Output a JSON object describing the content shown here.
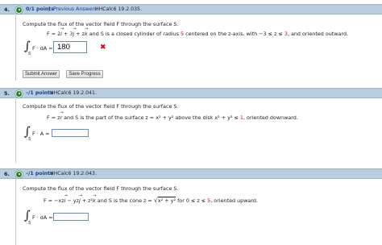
{
  "questions": [
    {
      "number": "4.",
      "points": "0/1 points",
      "separator": "|",
      "previous_answers": "Previous Answers",
      "code": "HHCalc6 19.2.035.",
      "prompt": "Compute the flux of the vector field F through the surface S.",
      "field_prefix": "F = 2",
      "field_i": "i",
      "field_mid1": " + 3",
      "field_j": "j",
      "field_mid2": " + z",
      "field_k": "k",
      "surface_text": " and S is a closed cylinder of radius ",
      "radius": "5",
      "surface_text2": " centered on the z-axis, with −3 ≤ z ≤ ",
      "z_upper": "3",
      "surface_text3": ",  and oriented outward.",
      "integrand": "F · dA =",
      "answer_value": "180",
      "status_mark": "✖",
      "submit_label": "Submit Answer",
      "save_label": "Save Progress"
    },
    {
      "number": "5.",
      "points": "–/1 points",
      "code": "HHCalc6 19.2.041.",
      "prompt": "Compute the flux of the vector field F through the surface S.",
      "field_prefix": "F = z",
      "field_r": "r",
      "surface_text": " and S is the part of the surface  z = x² + y²  above the disk  x² + y² ≤ ",
      "bound": "1",
      "surface_text2": ",  oriented downward.",
      "integrand": "F · A ="
    },
    {
      "number": "6.",
      "points": "–/1 points",
      "code": "HHCalc6 19.2.043.",
      "prompt": "Compute the flux of the vector field F through the surface S.",
      "field_text": "F = −xz",
      "field_i": "i",
      "field_mid1": " − yz",
      "field_j": "j",
      "field_mid2": " + z²",
      "field_k": "k",
      "surface_text": " and S is the cone  z = ",
      "sqrt_text": "x² + y²",
      "surface_text2": "  for  0 ≤ z ≤ ",
      "z_upper": "5",
      "surface_text3": ",  oriented upward.",
      "integrand": "F · dA ="
    }
  ],
  "colors": {
    "header_bg": "#b9cde0",
    "points_text": "#1a3c8a",
    "status_dot": "#2e7d32",
    "highlight_red": "#d0021b"
  },
  "icons": {
    "status": "circle-dot-icon",
    "wrong": "x-mark-icon"
  }
}
